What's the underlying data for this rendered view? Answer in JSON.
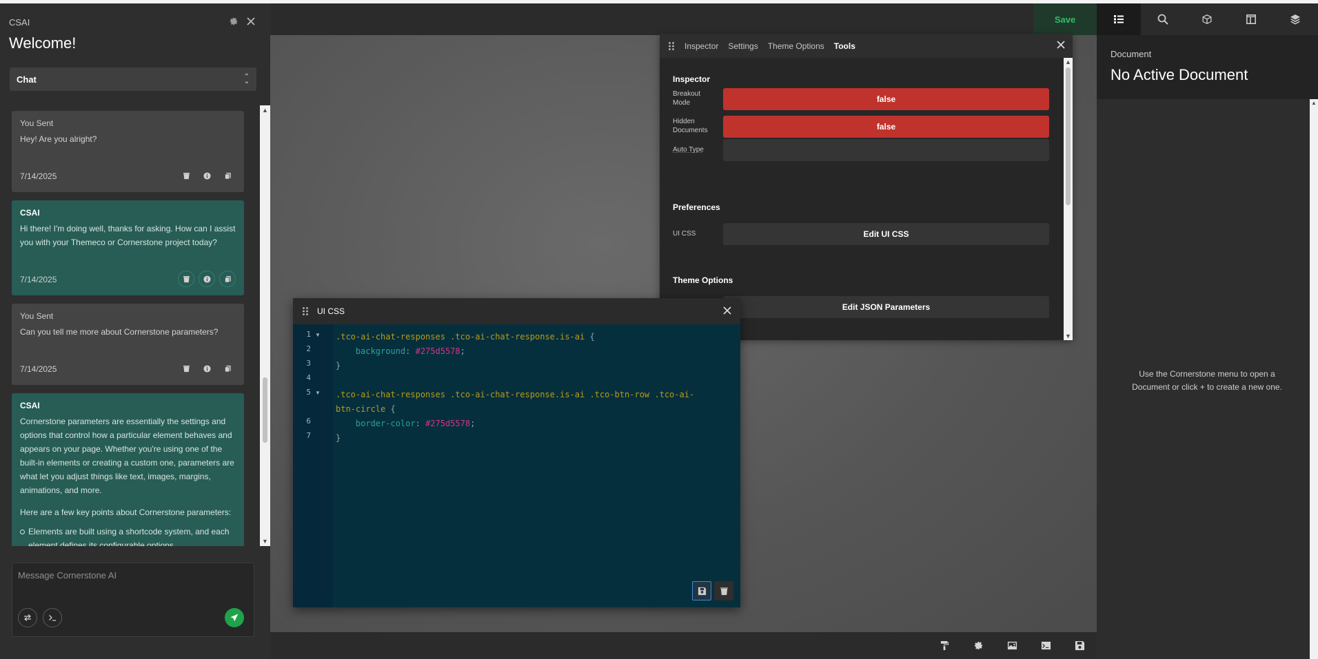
{
  "left_panel": {
    "app_name": "CSAI",
    "welcome": "Welcome!",
    "mode_select": {
      "value": "Chat"
    },
    "messages": [
      {
        "sender": "You Sent",
        "text": "Hey! Are you alright?",
        "date": "7/14/2025"
      },
      {
        "sender": "CSAI",
        "text": "Hi there! I'm doing well, thanks for asking. How can I assist you with your Themeco or Cornerstone project today?",
        "date": "7/14/2025"
      },
      {
        "sender": "You Sent",
        "text": "Can you tell me more about Cornerstone parameters?",
        "date": "7/14/2025"
      },
      {
        "sender": "CSAI",
        "paragraph1": "Cornerstone parameters are essentially the settings and options that control how a particular element behaves and appears on your page. Whether you're using one of the built-in elements or creating a custom one, parameters are what let you adjust things like text, images, margins, animations, and more.",
        "paragraph2": "Here are a few key points about Cornerstone parameters:",
        "bullets": [
          "Elements are built using a shortcode system, and each element defines its configurable options."
        ]
      }
    ],
    "composer": {
      "placeholder": "Message Cornerstone AI"
    }
  },
  "topbar": {
    "save_label": "Save",
    "icons": [
      "list-icon",
      "search-icon",
      "cube-icon",
      "layout-icon",
      "layers-icon"
    ]
  },
  "tools_panel": {
    "tabs": [
      "Inspector",
      "Settings",
      "Theme Options",
      "Tools"
    ],
    "active_tab": "Tools",
    "inspector": {
      "title": "Inspector",
      "breakout_mode": {
        "label": "Breakout Mode",
        "value": "false"
      },
      "hidden_documents": {
        "label": "Hidden Documents",
        "value": "false"
      },
      "auto_type": {
        "label": "Auto Type",
        "value": ""
      }
    },
    "preferences": {
      "title": "Preferences",
      "ui_css": {
        "label": "UI CSS",
        "button": "Edit UI CSS"
      }
    },
    "theme_options": {
      "title": "Theme Options",
      "button": "Edit JSON Parameters"
    }
  },
  "css_panel": {
    "title": "UI CSS",
    "line_numbers": [
      "1",
      "2",
      "3",
      "4",
      "5",
      "6",
      "7"
    ],
    "code": {
      "l1_selector": ".tco-ai-chat-responses .tco-ai-chat-response.is-ai",
      "l2_property": "background",
      "l2_value": "#275d5578",
      "l5_selector_a": ".tco-ai-chat-responses .tco-ai-chat-response.is-ai .tco-btn-row .tco-ai-",
      "l5_selector_b": "btn-circle",
      "l6_property": "border-color",
      "l6_value": "#275d5578"
    }
  },
  "bottombar": {
    "icons": [
      "paint-roller-icon",
      "gear-icon",
      "image-icon",
      "terminal-icon",
      "save-icon"
    ]
  },
  "right_panel": {
    "label": "Document",
    "title": "No Active Document",
    "hint": "Use the Cornerstone menu to open a Document or click + to create a new one."
  },
  "colors": {
    "ai_message_bg": "#275d55",
    "false_button": "#c0332d",
    "save_text": "#2fbf6a",
    "send_button": "#1fa34a",
    "code_bg": "#062f3d"
  }
}
